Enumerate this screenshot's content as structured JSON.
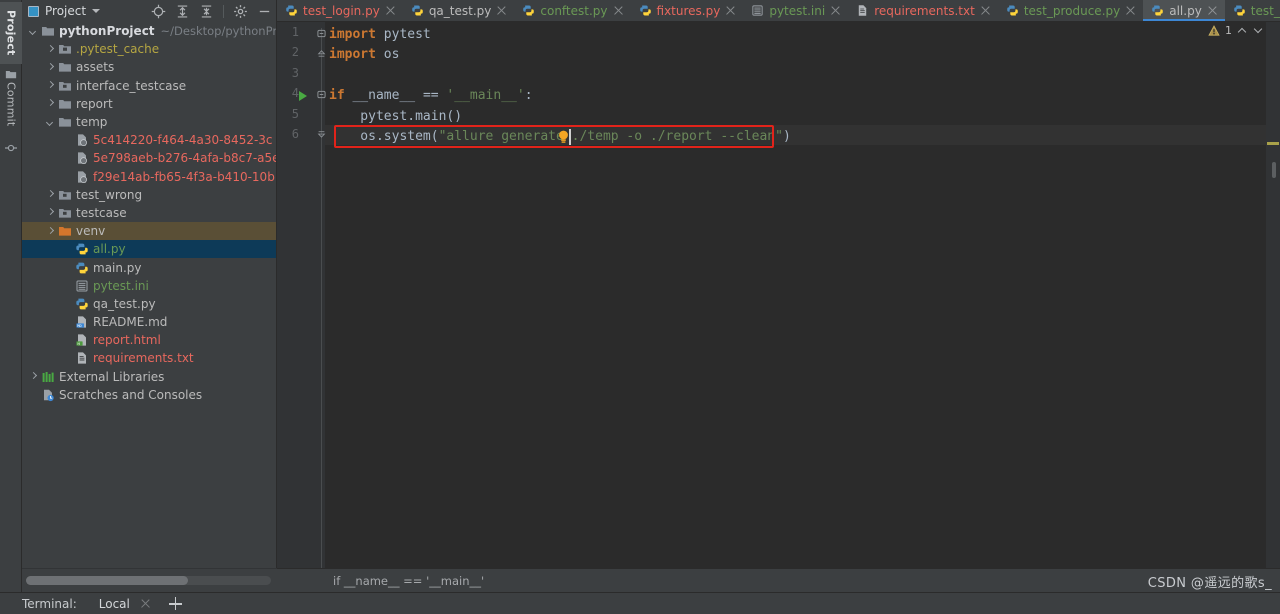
{
  "rail": {
    "items": [
      {
        "label": "Project",
        "icon": "folder-icon",
        "active": true
      },
      {
        "label": "Commit",
        "icon": "commit-icon",
        "active": false
      }
    ]
  },
  "project_panel": {
    "title": "Project",
    "icon": "project-window-icon",
    "tools": [
      {
        "name": "select-opened-file-icon",
        "label": "Select Opened File"
      },
      {
        "name": "expand-all-icon",
        "label": "Expand All"
      },
      {
        "name": "collapse-all-icon",
        "label": "Collapse All"
      },
      {
        "name": "gear-icon",
        "label": "Options"
      },
      {
        "name": "hide-icon",
        "label": "Hide"
      }
    ],
    "tree": [
      {
        "label": "pythonProject",
        "path": "~/Desktop/pythonProj",
        "icon": "folder-icon",
        "arrow": "down",
        "indent": 0,
        "style": "root",
        "state": "normal"
      },
      {
        "label": ".pytest_cache",
        "icon": "folder-excluded-icon",
        "arrow": "right",
        "indent": 1,
        "style": "excluded",
        "state": "normal"
      },
      {
        "label": "assets",
        "icon": "folder-icon",
        "arrow": "right",
        "indent": 1,
        "style": "plain",
        "state": "normal"
      },
      {
        "label": "interface_testcase",
        "icon": "folder-source-icon",
        "arrow": "right",
        "indent": 1,
        "style": "plain",
        "state": "normal"
      },
      {
        "label": "report",
        "icon": "folder-icon",
        "arrow": "right",
        "indent": 1,
        "style": "plain",
        "state": "normal"
      },
      {
        "label": "temp",
        "icon": "folder-icon",
        "arrow": "down",
        "indent": 1,
        "style": "plain",
        "state": "normal"
      },
      {
        "label": "5c414220-f464-4a30-8452-3c",
        "icon": "attachment-file-icon",
        "arrow": "none",
        "indent": 2,
        "style": "modified",
        "state": "normal"
      },
      {
        "label": "5e798aeb-b276-4afa-b8c7-a5e",
        "icon": "attachment-file-icon",
        "arrow": "none",
        "indent": 2,
        "style": "modified",
        "state": "normal"
      },
      {
        "label": "f29e14ab-fb65-4f3a-b410-10b",
        "icon": "attachment-file-icon",
        "arrow": "none",
        "indent": 2,
        "style": "modified",
        "state": "normal"
      },
      {
        "label": "test_wrong",
        "icon": "folder-source-icon",
        "arrow": "right",
        "indent": 1,
        "style": "plain",
        "state": "normal"
      },
      {
        "label": "testcase",
        "icon": "folder-source-icon",
        "arrow": "right",
        "indent": 1,
        "style": "plain",
        "state": "normal"
      },
      {
        "label": "venv",
        "icon": "folder-excluded-orange-icon",
        "arrow": "right",
        "indent": 1,
        "style": "plain",
        "state": "hover"
      },
      {
        "label": "all.py",
        "icon": "python-file-icon",
        "arrow": "none",
        "indent": 2,
        "style": "modified-green",
        "state": "selected"
      },
      {
        "label": "main.py",
        "icon": "python-file-icon",
        "arrow": "none",
        "indent": 2,
        "style": "plain",
        "state": "normal"
      },
      {
        "label": "pytest.ini",
        "icon": "ini-file-icon",
        "arrow": "none",
        "indent": 2,
        "style": "modified-green",
        "state": "normal"
      },
      {
        "label": "qa_test.py",
        "icon": "python-file-icon",
        "arrow": "none",
        "indent": 2,
        "style": "plain",
        "state": "normal"
      },
      {
        "label": "README.md",
        "icon": "markdown-file-icon",
        "arrow": "none",
        "indent": 2,
        "style": "plain",
        "state": "normal"
      },
      {
        "label": "report.html",
        "icon": "html-file-icon",
        "arrow": "none",
        "indent": 2,
        "style": "modified",
        "state": "normal"
      },
      {
        "label": "requirements.txt",
        "icon": "text-file-icon",
        "arrow": "none",
        "indent": 2,
        "style": "modified",
        "state": "normal"
      },
      {
        "label": "External Libraries",
        "icon": "libraries-icon",
        "arrow": "right",
        "indent": 0,
        "style": "plain",
        "state": "normal"
      },
      {
        "label": "Scratches and Consoles",
        "icon": "scratches-icon",
        "arrow": "none",
        "indent": 0,
        "style": "plain",
        "state": "normal"
      }
    ]
  },
  "editor": {
    "tabs": [
      {
        "label": "test_login.py",
        "icon": "python-file-icon",
        "color": "modified",
        "active": false
      },
      {
        "label": "qa_test.py",
        "icon": "python-file-icon",
        "color": "plain",
        "active": false
      },
      {
        "label": "conftest.py",
        "icon": "python-file-icon",
        "color": "modified-green",
        "active": false
      },
      {
        "label": "fixtures.py",
        "icon": "python-file-icon",
        "color": "modified",
        "active": false
      },
      {
        "label": "pytest.ini",
        "icon": "ini-file-icon",
        "color": "modified-green",
        "active": false
      },
      {
        "label": "requirements.txt",
        "icon": "text-file-icon",
        "color": "modified",
        "active": false
      },
      {
        "label": "test_produce.py",
        "icon": "python-file-icon",
        "color": "modified-green",
        "active": false
      },
      {
        "label": "all.py",
        "icon": "python-file-icon",
        "color": "plain",
        "active": true
      },
      {
        "label": "test_wrong.py",
        "icon": "python-file-icon",
        "color": "modified-green",
        "active": false
      }
    ],
    "line_numbers": [
      "1",
      "2",
      "3",
      "4",
      "5",
      "6"
    ],
    "code_lines": [
      {
        "n": 1,
        "tokens": [
          {
            "t": "import",
            "c": "kw"
          },
          {
            "t": " pytest",
            "c": "id"
          }
        ]
      },
      {
        "n": 2,
        "tokens": [
          {
            "t": "import",
            "c": "kw"
          },
          {
            "t": " os",
            "c": "id"
          }
        ]
      },
      {
        "n": 3,
        "tokens": []
      },
      {
        "n": 4,
        "tokens": [
          {
            "t": "if",
            "c": "kw"
          },
          {
            "t": " __name__ ",
            "c": "id"
          },
          {
            "t": "==",
            "c": "punc"
          },
          {
            "t": " ",
            "c": "id"
          },
          {
            "t": "'__main__'",
            "c": "str"
          },
          {
            "t": ":",
            "c": "punc"
          }
        ]
      },
      {
        "n": 5,
        "tokens": [
          {
            "t": "    pytest.main()",
            "c": "id"
          }
        ]
      },
      {
        "n": 6,
        "tokens": [
          {
            "t": "    os.system(",
            "c": "id"
          },
          {
            "t": "\"allure generate ./temp -o ./report --clean\"",
            "c": "str"
          },
          {
            "t": ")",
            "c": "punc"
          }
        ]
      }
    ],
    "run_arrow_line": 4,
    "current_line": 6,
    "highlight_box_line": 6,
    "intention_bulb": "lightbulb-icon",
    "warning_count": "1",
    "warning_icon": "warning-triangle-icon",
    "nav_up_icon": "chevron-up-icon",
    "nav_down_icon": "chevron-down-icon",
    "breadcrumb": "if __name__ == '__main__'"
  },
  "bottom_bar": {
    "terminal_label": "Terminal:",
    "session_label": "Local",
    "close_icon": "close-icon",
    "add_icon": "plus-icon"
  },
  "watermark": "CSDN @遥远的歌s_",
  "colors": {
    "background": "#3c3f41",
    "editor_background": "#2b2b2b",
    "selection": "#0d3a58",
    "hover": "#5a4f36",
    "accent": "#3d87d4",
    "keyword": "#cc7832",
    "string": "#6a8759",
    "modified": "#e8685e",
    "modified_green": "#6a9955",
    "warning": "#a9a14a",
    "highlight_box": "#e2231a"
  }
}
